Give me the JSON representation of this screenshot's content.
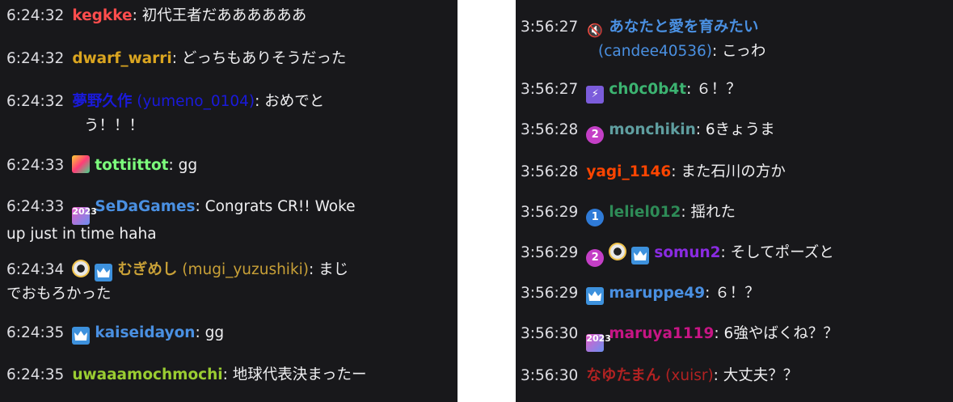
{
  "left_chat": [
    {
      "time": "6:24:32",
      "user": "kegkke",
      "color": "#ff4d4d",
      "text": "初代王者だああああああ"
    },
    {
      "time": "6:24:32",
      "user": "dwarf_warri",
      "color": "#daa520",
      "text": "どっちもありそうだった"
    },
    {
      "time": "6:24:32",
      "user": "夢野久作",
      "login": "(yumeno_0104)",
      "color": "#1a1adb",
      "text": "おめでと",
      "cont": "う！！！"
    },
    {
      "time": "6:24:33",
      "user": "tottiittot",
      "color": "#7cfc7c",
      "text": "gg"
    },
    {
      "time": "6:24:33",
      "user": "SeDaGames",
      "color": "#4a90e2",
      "text": "Congrats CR!! Woke",
      "cont": "up just in time haha"
    },
    {
      "time": "6:24:34",
      "user": "むぎめし",
      "login": "(mugi_yuzushiki)",
      "color": "#c8a037",
      "text": "まじ",
      "cont": "でおもろかった"
    },
    {
      "time": "6:24:35",
      "user": "kaiseidayon",
      "color": "#4a90e2",
      "text": "gg"
    },
    {
      "time": "6:24:35",
      "user": "uwaaamochmochi",
      "color": "#9acd32",
      "text": "地球代表決まったー"
    }
  ],
  "right_chat": [
    {
      "time": "3:56:27",
      "user": "あなたと愛を育みたい",
      "login": "(candee40536)",
      "color": "#4a90e2",
      "text": "こっわ"
    },
    {
      "time": "3:56:27",
      "user": "ch0c0b4t",
      "color": "#3cb371",
      "text": "６！？"
    },
    {
      "time": "3:56:28",
      "user": "monchikin",
      "color": "#5f9ea0",
      "text": "6きょうま"
    },
    {
      "time": "3:56:28",
      "user": "yagi_1146",
      "color": "#ff4500",
      "text": "また石川の方か"
    },
    {
      "time": "3:56:29",
      "user": "leliel012",
      "color": "#2e8b57",
      "text": "揺れた"
    },
    {
      "time": "3:56:29",
      "user": "somun2",
      "color": "#8a2be2",
      "text": "そしてポーズと"
    },
    {
      "time": "3:56:29",
      "user": "maruppe49",
      "color": "#4a90e2",
      "text": "６！？"
    },
    {
      "time": "3:56:30",
      "user": "maruya1119",
      "color": "#c71585",
      "text": "6強やばくね？？"
    },
    {
      "time": "3:56:30",
      "user": "なゆたまん",
      "login": "(xuisr)",
      "color": "#b22222",
      "text": "大丈夫？？"
    }
  ],
  "badges": {
    "sub_2": "2",
    "sub_1": "1",
    "year": "2023"
  },
  "colors": {
    "panel_bg": "#18181b",
    "text": "#efeff1",
    "timestamp": "#dedee3"
  }
}
